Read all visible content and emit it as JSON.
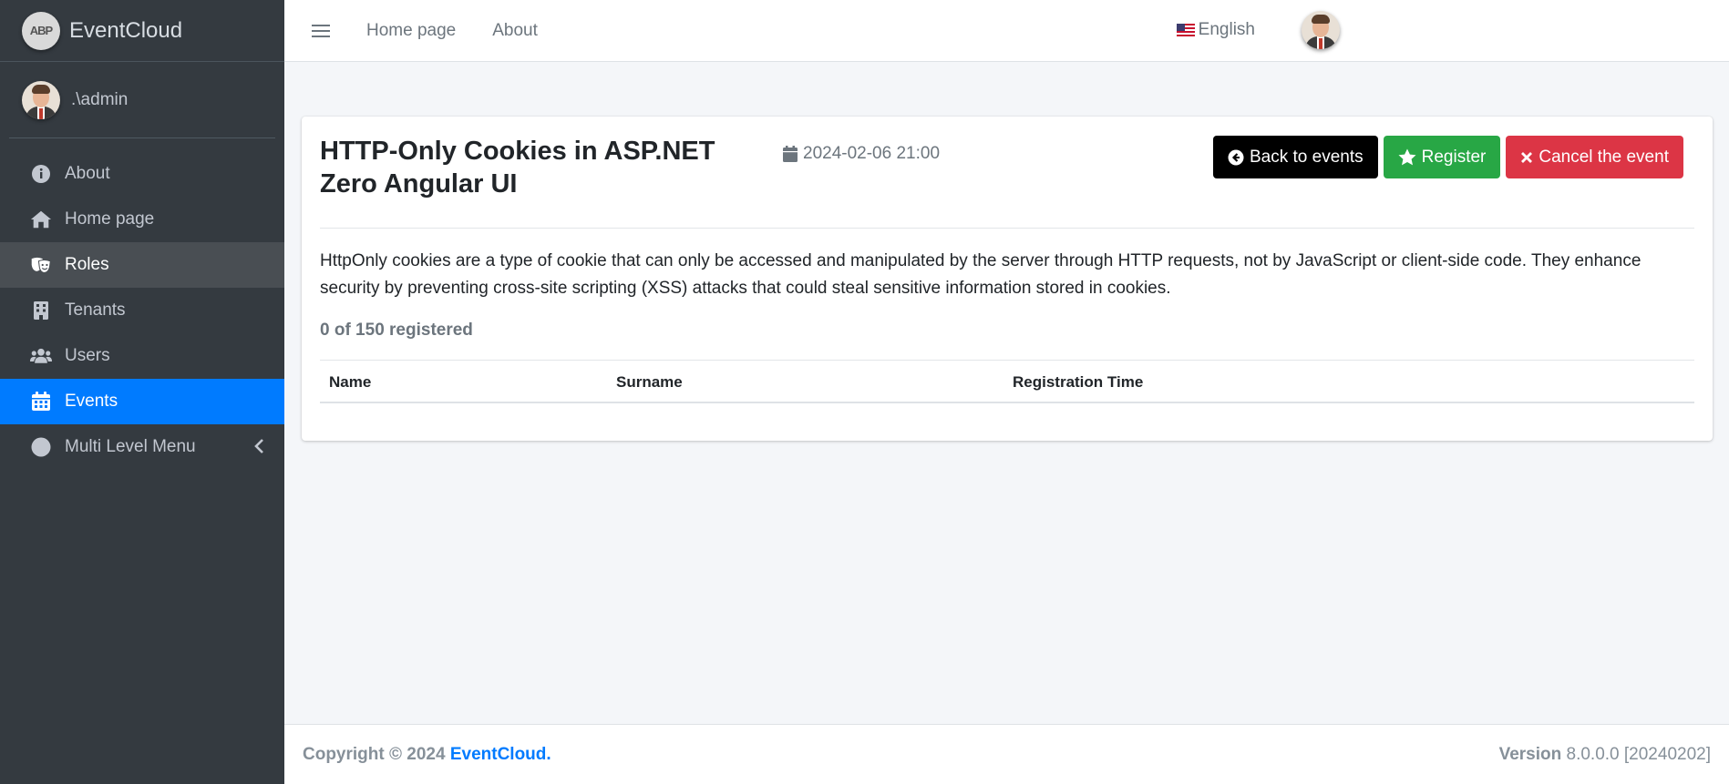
{
  "brand": {
    "name": "EventCloud",
    "logo_text": "ABP"
  },
  "user": {
    "name": ".\\admin"
  },
  "sidebar": {
    "items": [
      {
        "label": "About",
        "icon": "info-circle-icon"
      },
      {
        "label": "Home page",
        "icon": "home-icon"
      },
      {
        "label": "Roles",
        "icon": "theater-masks-icon"
      },
      {
        "label": "Tenants",
        "icon": "building-icon"
      },
      {
        "label": "Users",
        "icon": "users-icon"
      },
      {
        "label": "Events",
        "icon": "calendar-icon"
      },
      {
        "label": "Multi Level Menu",
        "icon": "circle-icon"
      }
    ],
    "active_item": "Events",
    "hover_item": "Roles"
  },
  "topbar": {
    "links": [
      "Home page",
      "About"
    ],
    "language": "English"
  },
  "event": {
    "title": "HTTP-Only Cookies in ASP.NET Zero Angular UI",
    "date": "2024-02-06 21:00",
    "description": "HttpOnly cookies are a type of cookie that can only be accessed and manipulated by the server through HTTP requests, not by JavaScript or client-side code. They enhance security by preventing cross-site scripting (XSS) attacks that could steal sensitive information stored in cookies.",
    "registration_count": "0 of 150 registered",
    "buttons": {
      "back": "Back to events",
      "register": "Register",
      "cancel": "Cancel the event"
    },
    "table_headers": [
      "Name",
      "Surname",
      "Registration Time"
    ]
  },
  "footer": {
    "copyright_prefix": "Copyright © 2024",
    "brand": "EventCloud",
    "suffix": ".",
    "version_label": "Version",
    "version_value": "8.0.0.0 [20240202]"
  },
  "colors": {
    "sidebar_bg": "#343a40",
    "active": "#007bff",
    "success": "#28a745",
    "danger": "#dc3545"
  }
}
